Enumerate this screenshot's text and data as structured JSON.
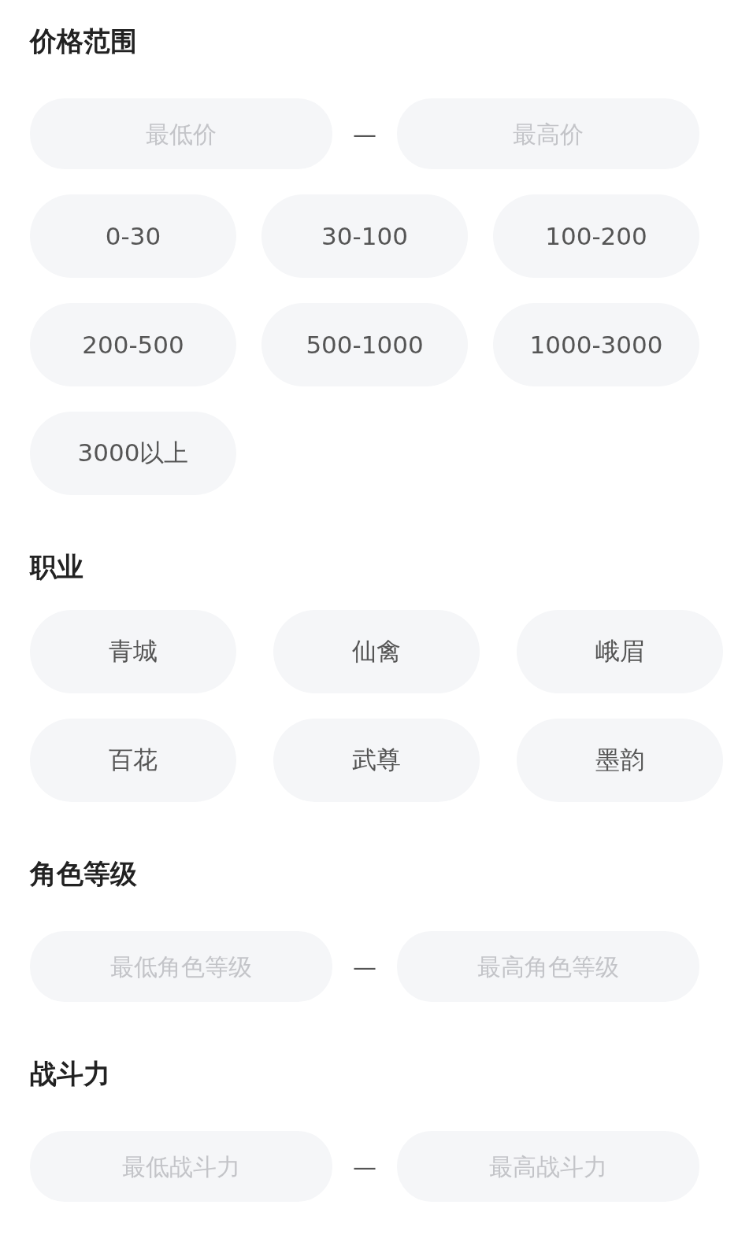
{
  "sections": [
    {
      "title": "价格范围",
      "range": {
        "min_placeholder": "最低价",
        "separator": "—",
        "max_placeholder": "最高价"
      },
      "options": [
        "0-30",
        "30-100",
        "100-200",
        "200-500",
        "500-1000",
        "1000-3000",
        "3000以上"
      ]
    },
    {
      "title": "职业",
      "options": [
        "青城",
        "仙禽",
        "峨眉",
        "百花",
        "武尊",
        "墨韵"
      ]
    },
    {
      "title": "角色等级",
      "range": {
        "min_placeholder": "最低角色等级",
        "separator": "—",
        "max_placeholder": "最高角色等级"
      }
    },
    {
      "title": "战斗力",
      "range": {
        "min_placeholder": "最低战斗力",
        "separator": "—",
        "max_placeholder": "最高战斗力"
      }
    }
  ]
}
